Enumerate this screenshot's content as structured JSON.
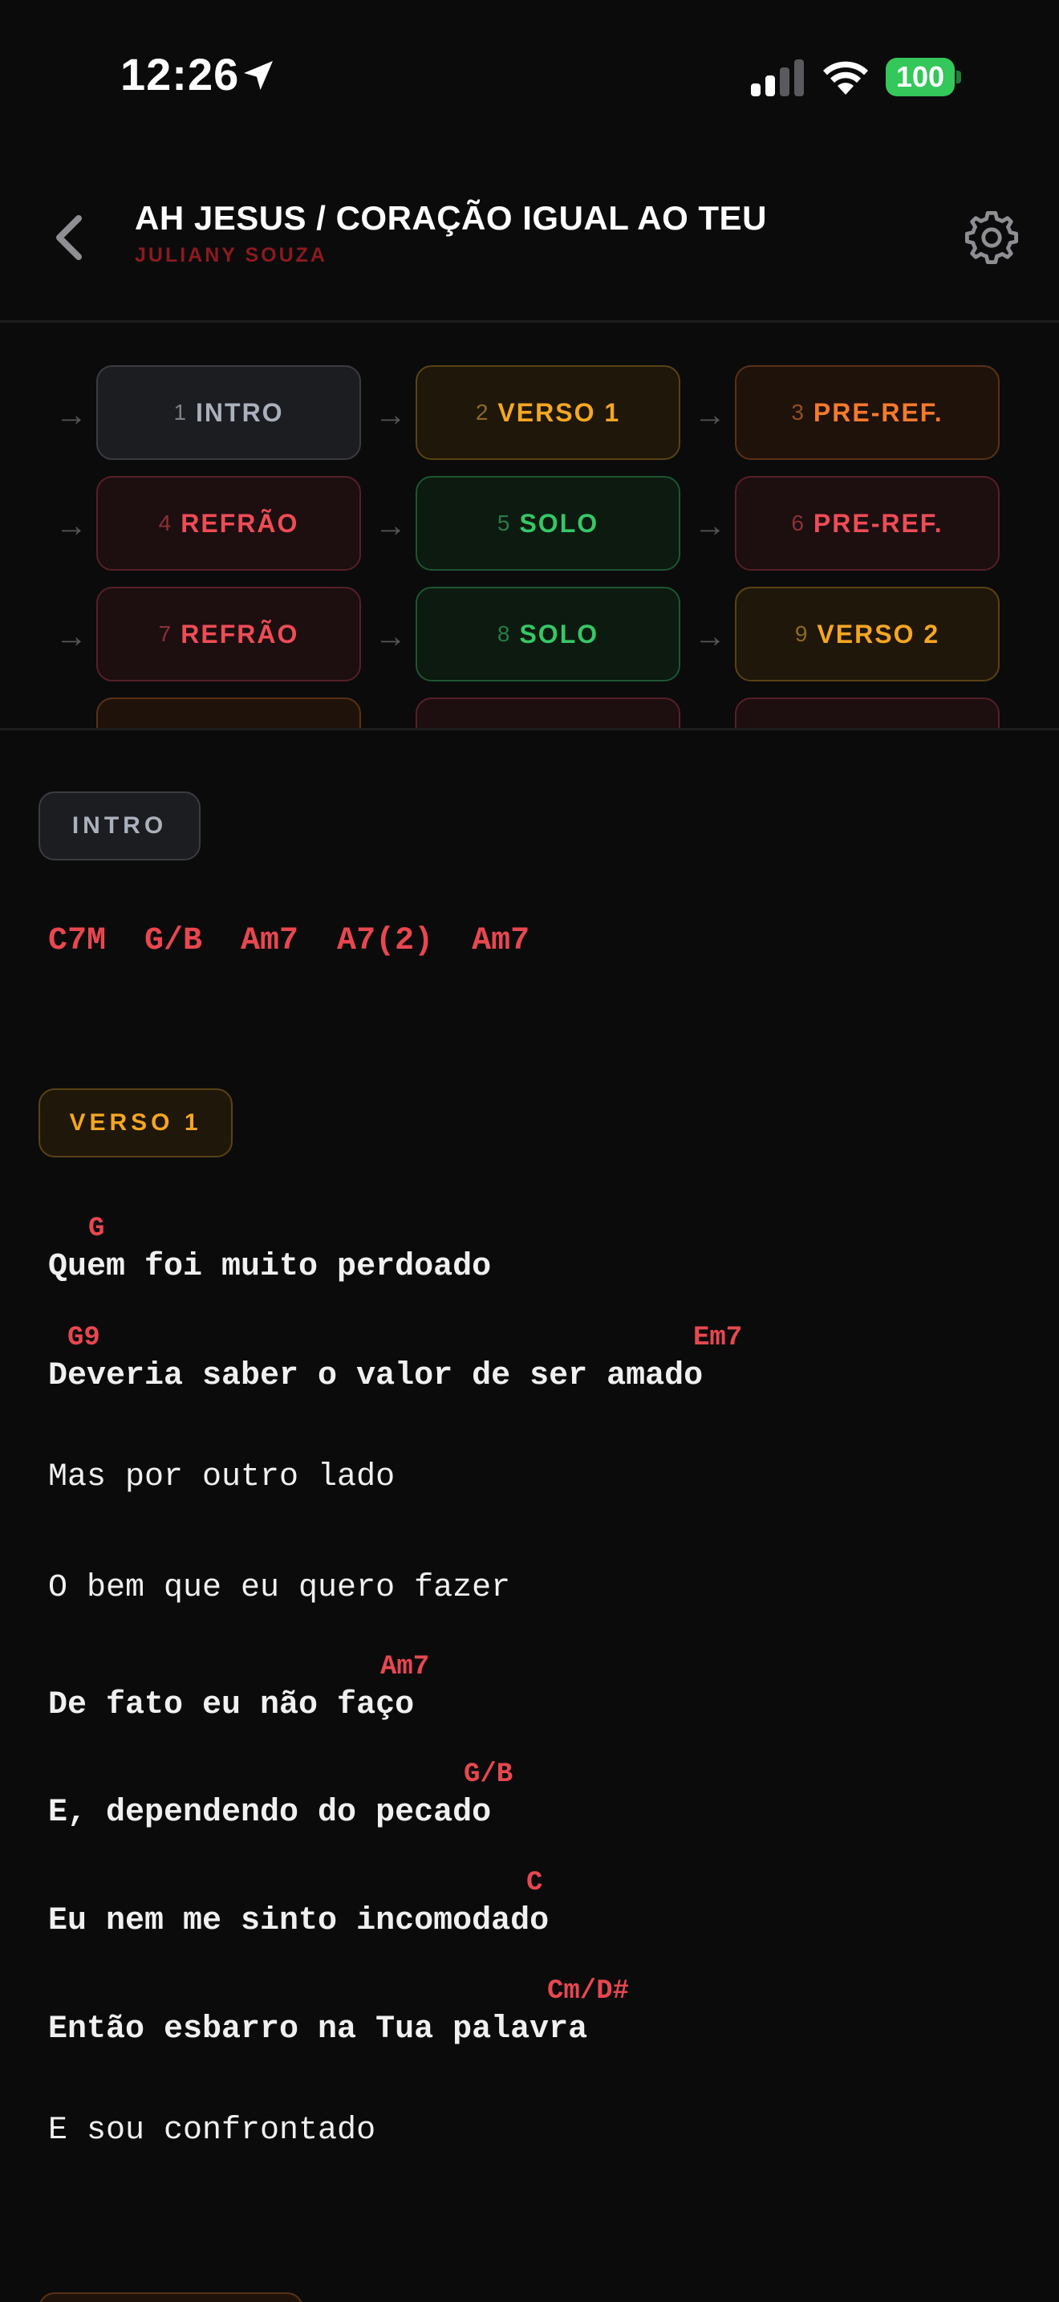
{
  "status_bar": {
    "time": "12:26",
    "battery": "100"
  },
  "header": {
    "title": "AH JESUS / CORAÇÃO IGUAL AO TEU",
    "artist": "JULIANY SOUZA"
  },
  "section_map": {
    "arrow": "→",
    "sections": [
      {
        "num": "1",
        "label": "INTRO"
      },
      {
        "num": "2",
        "label": "VERSO 1"
      },
      {
        "num": "3",
        "label": "PRE-REF."
      },
      {
        "num": "4",
        "label": "REFRÃO"
      },
      {
        "num": "5",
        "label": "SOLO"
      },
      {
        "num": "6",
        "label": "PRE-REF."
      },
      {
        "num": "7",
        "label": "REFRÃO"
      },
      {
        "num": "8",
        "label": "SOLO"
      },
      {
        "num": "9",
        "label": "VERSO 2"
      }
    ]
  },
  "intro": {
    "label": "INTRO",
    "chords": "C7M  G/B  Am7  A7(2)  Am7"
  },
  "verse1": {
    "label": "VERSO 1",
    "lines": [
      {
        "chords": [
          "G"
        ],
        "text": "Quem foi muito perdoado"
      },
      {
        "chords": [
          "G9",
          "Em7"
        ],
        "text": "Deveria saber o valor de ser amado"
      },
      {
        "chords": [],
        "text": "Mas por outro lado"
      },
      {
        "chords": [],
        "text": "O bem que eu quero fazer"
      },
      {
        "chords": [
          "Am7"
        ],
        "text": "De fato eu não faço"
      },
      {
        "chords": [
          "G/B"
        ],
        "text": "E, dependendo do pecado"
      },
      {
        "chords": [
          "C"
        ],
        "text": "Eu nem me sinto incomodado"
      },
      {
        "chords": [
          "Cm/D#"
        ],
        "text": "Então esbarro na Tua palavra"
      },
      {
        "chords": [],
        "text": "E sou confrontado"
      }
    ]
  }
}
